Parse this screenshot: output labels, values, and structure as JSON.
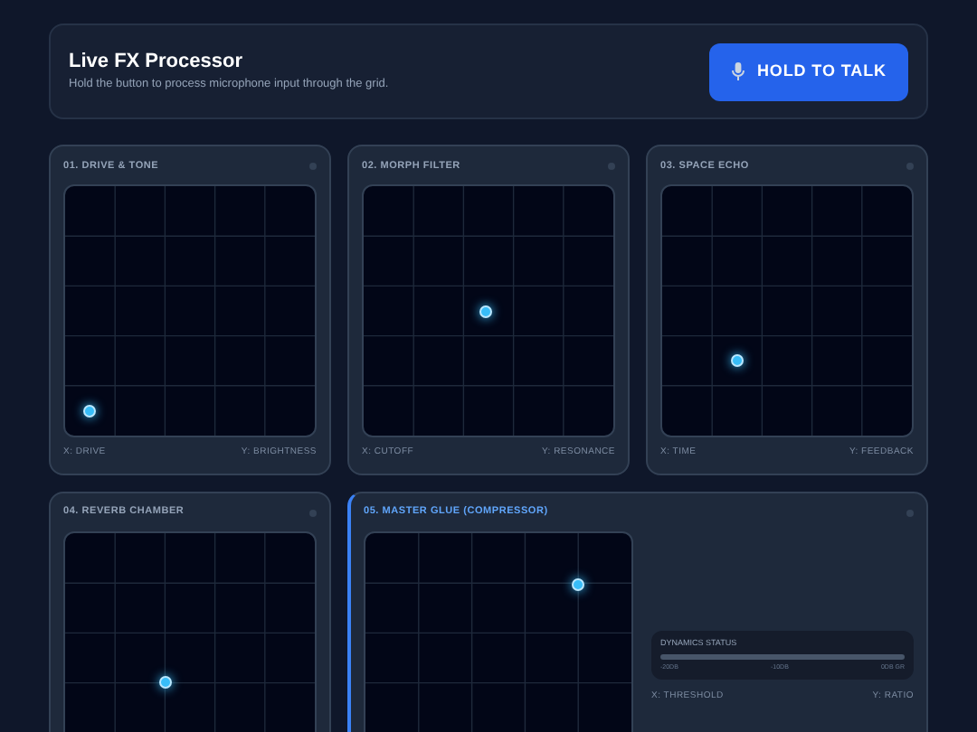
{
  "header": {
    "title": "Live FX Processor",
    "subtitle": "Hold the button to process microphone input through the grid.",
    "button": "HOLD TO TALK"
  },
  "modules": [
    {
      "title": "01. DRIVE & TONE",
      "selected": false,
      "pad": {
        "x": {
          "level": 0.1
        },
        "y": {
          "level": 0.1
        }
      },
      "x_label": "X: DRIVE",
      "y_label": "Y: BRIGHTNESS"
    },
    {
      "title": "02. MORPH FILTER",
      "selected": false,
      "pad": {
        "x": {
          "level": 0.49
        },
        "y": {
          "level": 0.5
        }
      },
      "x_label": "X: CUTOFF",
      "y_label": "Y: RESONANCE"
    },
    {
      "title": "03. SPACE ECHO",
      "selected": false,
      "pad": {
        "x": {
          "level": 0.3
        },
        "y": {
          "level": 0.3
        }
      },
      "x_label": "X: TIME",
      "y_label": "Y: FEEDBACK"
    },
    {
      "title": "04. REVERB CHAMBER",
      "selected": false,
      "pad": {
        "x": {
          "level": 0.4
        },
        "y": {
          "level": 0.4
        }
      }
    },
    {
      "title": "05. MASTER GLUE (COMPRESSOR)",
      "selected": true,
      "pad": {
        "x": {
          "level": 0.8
        },
        "y": {
          "level": 0.79
        }
      },
      "x_label": "X: THRESHOLD",
      "y_label": "Y: RATIO",
      "status": {
        "title": "DYNAMICS STATUS",
        "ticks": [
          "-20DB",
          "-10DB",
          "0DB GR"
        ]
      }
    }
  ]
}
